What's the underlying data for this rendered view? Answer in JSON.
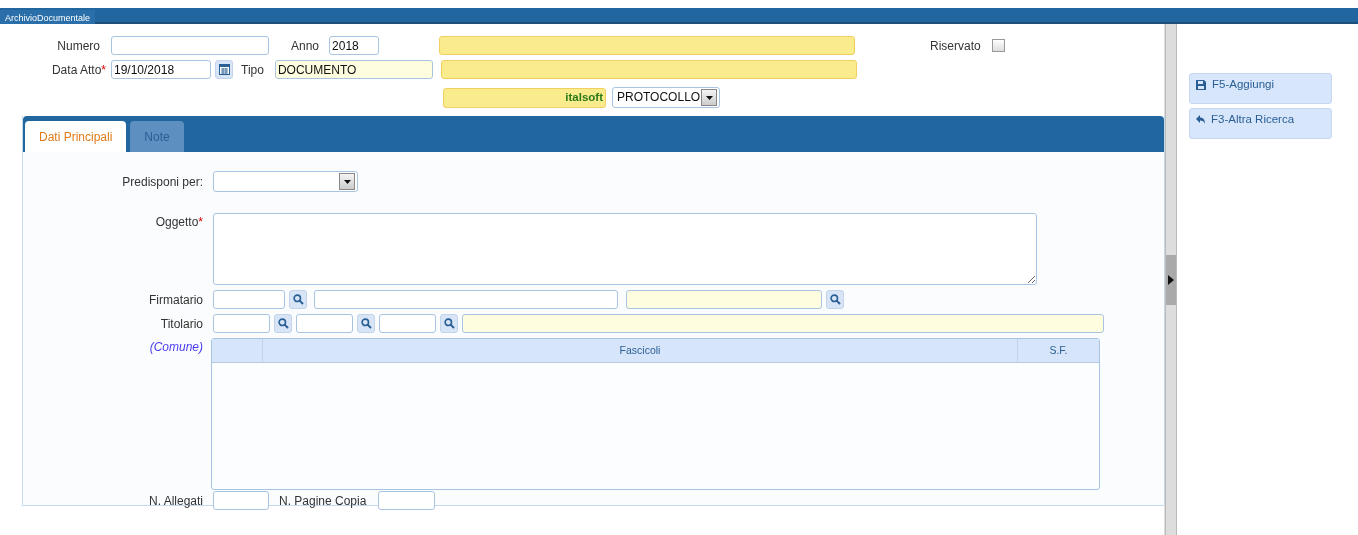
{
  "window": {
    "title": "ArchivioDocumentale"
  },
  "header": {
    "numero": {
      "label": "Numero"
    },
    "anno": {
      "label": "Anno",
      "value": "2018"
    },
    "data_atto": {
      "label": "Data Atto",
      "required_mark": "*",
      "value": "19/10/2018"
    },
    "tipo": {
      "label": "Tipo",
      "value": "DOCUMENTO"
    },
    "riservato": {
      "label": "Riservato",
      "checked": false
    },
    "brand": "italsoft",
    "registro": {
      "value": "PROTOCOLLO"
    }
  },
  "tabs": [
    {
      "label": "Dati Principali",
      "selected": true
    },
    {
      "label": "Note",
      "selected": false
    }
  ],
  "form": {
    "predisponi": {
      "label": "Predisponi per:"
    },
    "oggetto": {
      "label": "Oggetto",
      "required_mark": "*"
    },
    "firmatario": {
      "label": "Firmatario"
    },
    "titolario": {
      "label": "Titolario"
    },
    "comune": {
      "label": "(Comune)"
    },
    "fascicoli": {
      "columns": [
        "Fascicoli",
        "S.F."
      ]
    },
    "allegati": {
      "label": "N. Allegati"
    },
    "pagine": {
      "label": "N. Pagine Copia"
    }
  },
  "actions": [
    {
      "label": "F5-Aggiungi",
      "kind": "save"
    },
    {
      "label": "F3-Altra Ricerca",
      "kind": "back"
    }
  ]
}
